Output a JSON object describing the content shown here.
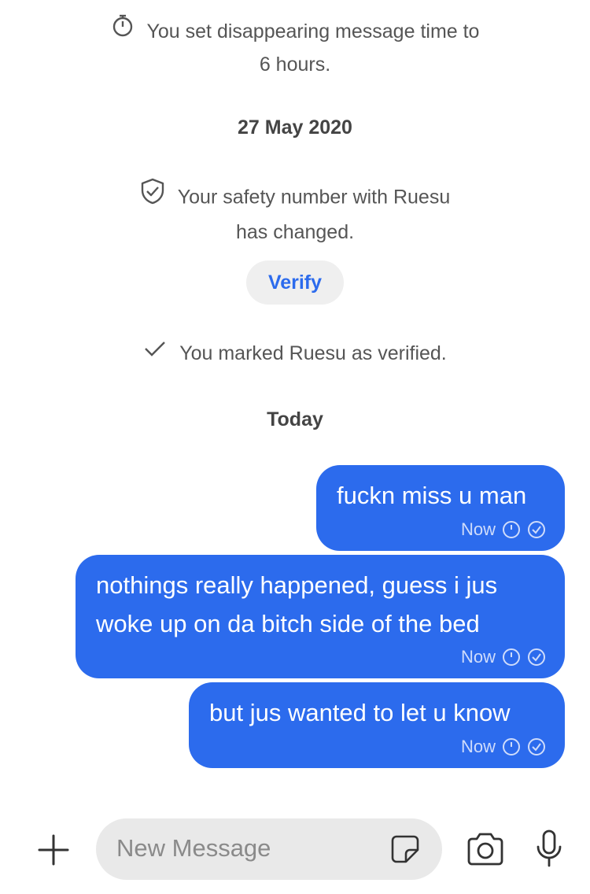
{
  "system_messages": {
    "disappearing": [
      "You set disappearing message time to",
      "6 hours."
    ],
    "safety": [
      "Your safety number with Ruesu",
      "has changed."
    ],
    "verified": "You marked Ruesu as verified."
  },
  "verify_button": "Verify",
  "date_headers": [
    "27 May 2020",
    "Today"
  ],
  "messages": [
    {
      "lines": [
        "fuckn miss u man"
      ],
      "time": "Now"
    },
    {
      "lines": [
        "nothings really happened, guess i jus",
        "woke up on da bitch side of the bed"
      ],
      "time": "Now"
    },
    {
      "lines": [
        "but jus wanted to let u know"
      ],
      "time": "Now"
    }
  ],
  "composer": {
    "placeholder": "New Message"
  },
  "icons": [
    "timer-icon",
    "shield-check-icon",
    "checkmark-icon",
    "plus-icon",
    "sticker-icon",
    "camera-icon",
    "microphone-icon",
    "clock-icon",
    "delivered-check-icon"
  ],
  "colors": {
    "bubble": "#2c6bed",
    "accent": "#2c6bed"
  }
}
